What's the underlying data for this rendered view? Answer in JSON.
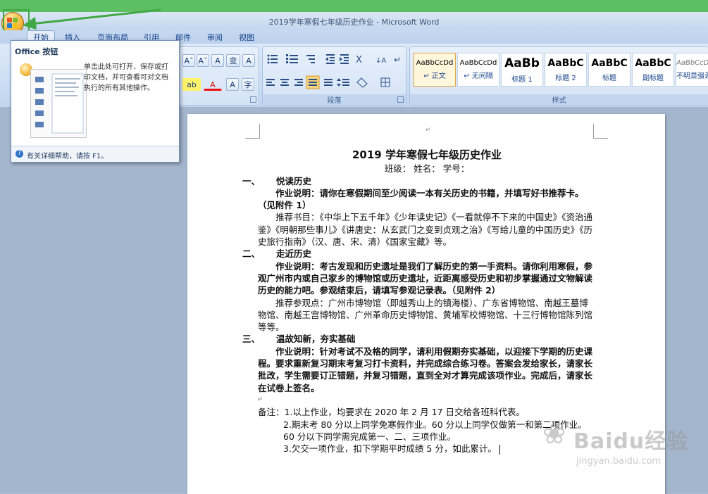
{
  "window": {
    "title": "2019学年寒假七年级历史作业 - Microsoft Word"
  },
  "tabs": [
    {
      "label": "开始",
      "active": true
    },
    {
      "label": "插入"
    },
    {
      "label": "页面布局"
    },
    {
      "label": "引用"
    },
    {
      "label": "邮件"
    },
    {
      "label": "审阅"
    },
    {
      "label": "视图"
    }
  ],
  "ribbon": {
    "font_group": {
      "grow": "Aˆ",
      "shrink": "Aˇ",
      "clear": "A",
      "phonetic": "变",
      "border_char": "A",
      "highlight": "ab",
      "font_color": "A",
      "shading": "A",
      "enclose": "字"
    },
    "paragraph_group": {
      "label": "段落"
    },
    "styles_group": {
      "label": "样式",
      "styles": [
        {
          "sample": "AaBbCcDd",
          "name": "↵ 正文",
          "selected": true
        },
        {
          "sample": "AaBbCcDd",
          "name": "↵ 无间隔"
        },
        {
          "sample": "AaBb",
          "name": "标题 1"
        },
        {
          "sample": "AaBbC",
          "name": "标题 2"
        },
        {
          "sample": "AaBbC",
          "name": "标题"
        },
        {
          "sample": "AaBbC",
          "name": "副标题"
        },
        {
          "sample": "AaBbCcDd",
          "name": "不明显强调"
        }
      ]
    }
  },
  "office_menu": {
    "title": "Office 按钮",
    "description": "单击此处可打开、保存或打印文档，并可查看可对文档执行的所有其他操作。",
    "footer": "有关详细帮助，请按 F1。"
  },
  "document": {
    "title": "2019 学年寒假七年级历史作业",
    "info_line": "班级：          姓名：          学号：",
    "sections": [
      {
        "num": "一、",
        "heading": "悦读历史",
        "instruction": "作业说明：请你在寒假期间至少阅读一本有关历史的书籍，并填写好书推荐卡。（见附件 1）",
        "body": "推荐书目：《中华上下五千年》《少年读史记》《一看就停不下来的中国史》《资治通鉴》《明朝那些事儿》《讲唐史：从玄武门之变到贞观之治》《写给儿童的中国历史》《历史旅行指南》（汉、唐、宋、清）《国家宝藏》等。"
      },
      {
        "num": "二、",
        "heading": "走近历史",
        "instruction": "作业说明：考古发现和历史遗址是我们了解历史的第一手资料。请你利用寒假，参观广州市内或自己家乡的博物馆或历史遗址，近距离感受历史和初步掌握通过文物解读历史的能力吧。参观结束后，请填写参观记录表。（见附件 2）",
        "body": "推荐参观点：广州市博物馆（即越秀山上的镇海楼）、广东省博物馆、南越王墓博物馆、南越王宫博物馆、广州革命历史博物馆、黄埔军校博物馆、十三行博物馆陈列馆等等。"
      },
      {
        "num": "三、",
        "heading": "温故知新，夯实基础",
        "instruction": "作业说明：针对考试不及格的同学，请利用假期夯实基础，以迎接下学期的历史课程。要求重新复习期末考复习打卡资料，并完成综合练习卷。答案会发给家长，请家长批改，学生需要订正错题，并复习错题，直到全对才算完成该项作业。完成后，请家长在试卷上签名。"
      }
    ],
    "notes_label": "备注：",
    "notes": [
      "1.以上作业，均要求在 2020 年 2 月 17 日交给各班科代表。",
      "2.期末考 80 分以上同学免寒假作业。60 分以上同学仅做第一和第二项作业。60 分以下同学需完成第一、二、三项作业。",
      "3.欠交一项作业，扣下学期平时成绩 5 分，如此累计。"
    ]
  },
  "watermark": {
    "text": "Baidu经验",
    "sub": "jingyan.baidu.com"
  },
  "colors": {
    "banner": "#5cbf62",
    "ribbon": "#dbe7f6",
    "workspace": "#a4b6cd"
  }
}
